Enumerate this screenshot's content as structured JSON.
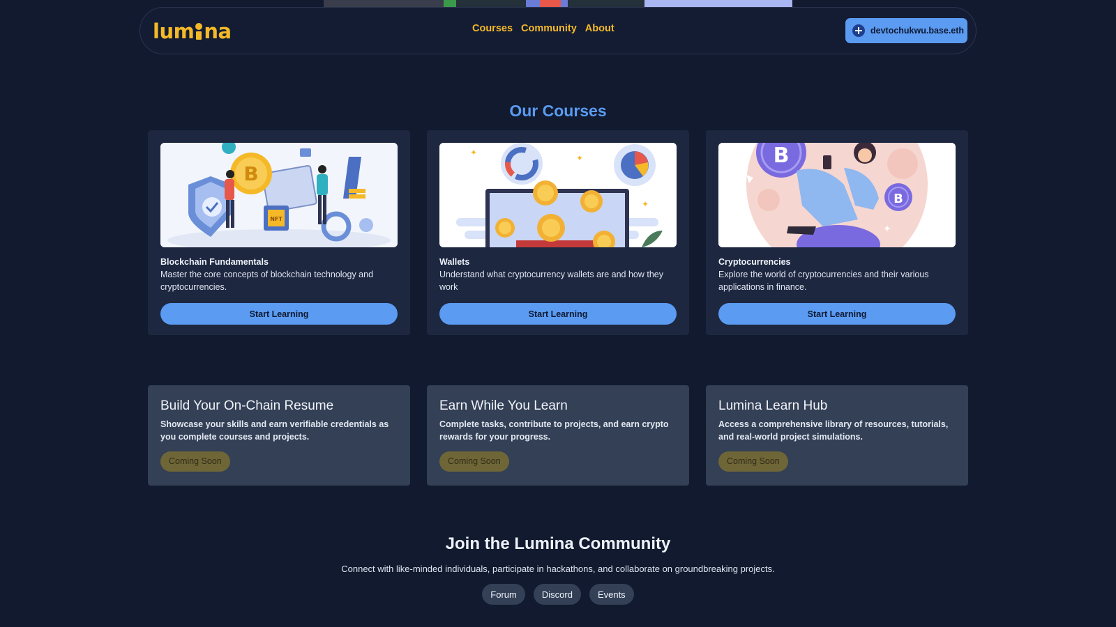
{
  "header": {
    "logo_text_before": "lum",
    "logo_text_after": "na",
    "nav": [
      {
        "label": "Courses"
      },
      {
        "label": "Community"
      },
      {
        "label": "About"
      }
    ],
    "wallet_label": "devtochukwu.base.eth"
  },
  "courses": {
    "title": "Our Courses",
    "items": [
      {
        "title": "Blockchain Fundamentals",
        "description": "Master the core concepts of blockchain technology and cryptocurrencies.",
        "button": "Start Learning"
      },
      {
        "title": "Wallets",
        "description": "Understand what cryptocurrency wallets are and how they work",
        "button": "Start Learning"
      },
      {
        "title": "Cryptocurrencies",
        "description": "Explore the world of cryptocurrencies and their various applications in finance.",
        "button": "Start Learning"
      }
    ]
  },
  "features": [
    {
      "title": "Build Your On-Chain Resume",
      "description": "Showcase your skills and earn verifiable credentials as you complete courses and projects.",
      "badge": "Coming Soon"
    },
    {
      "title": "Earn While You Learn",
      "description": "Complete tasks, contribute to projects, and earn crypto rewards for your progress.",
      "badge": "Coming Soon"
    },
    {
      "title": "Lumina Learn Hub",
      "description": "Access a comprehensive library of resources, tutorials, and real-world project simulations.",
      "badge": "Coming Soon"
    }
  ],
  "community": {
    "title": "Join the Lumina Community",
    "description": "Connect with like-minded individuals, participate in hackathons, and collaborate on groundbreaking projects.",
    "links": [
      {
        "label": "Forum"
      },
      {
        "label": "Discord"
      },
      {
        "label": "Events"
      }
    ]
  },
  "colors": {
    "background": "#111a2e",
    "accent_blue": "#5b9bf2",
    "accent_gold": "#f5b928",
    "card": "#1d2740",
    "feature_card": "#334055",
    "badge": "#6f6637"
  },
  "icons": {
    "wallet": "base-wallet-icon",
    "logo": "lightbulb-logo-icon"
  }
}
